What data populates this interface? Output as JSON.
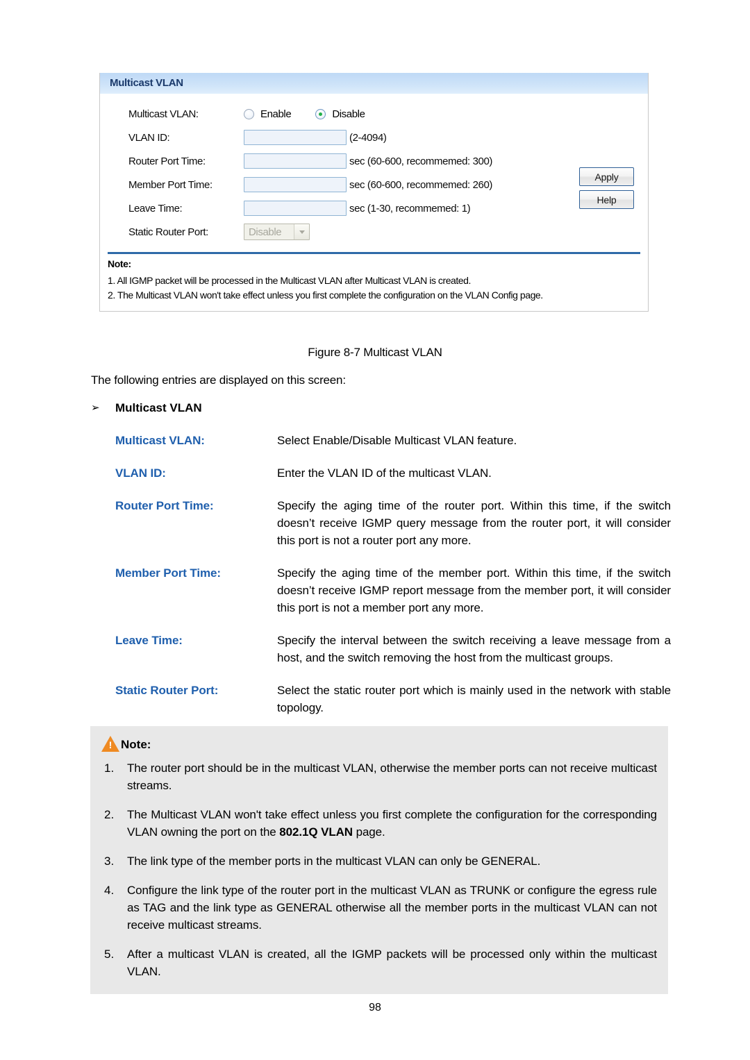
{
  "figure": {
    "panel_title": "Multicast VLAN",
    "rows": [
      {
        "label": "Multicast VLAN:",
        "type": "radio"
      },
      {
        "label": "VLAN ID:",
        "type": "text",
        "value": "",
        "hint": "(2-4094)"
      },
      {
        "label": "Router Port Time:",
        "type": "text",
        "value": "",
        "hint": "sec (60-600, recommemed: 300)"
      },
      {
        "label": "Member Port Time:",
        "type": "text",
        "value": "",
        "hint": "sec (60-600, recommemed: 260)"
      },
      {
        "label": "Leave Time:",
        "type": "text",
        "value": "",
        "hint": "sec (1-30, recommemed: 1)"
      },
      {
        "label": "Static Router Port:",
        "type": "select",
        "value": "Disable"
      }
    ],
    "radio": {
      "enable_label": "Enable",
      "disable_label": "Disable",
      "selected": "Disable"
    },
    "buttons": {
      "apply": "Apply",
      "help": "Help"
    },
    "note": {
      "heading": "Note:",
      "line1": "1. All IGMP packet will be processed in the Multicast VLAN after Multicast VLAN is created.",
      "line2": "2. The Multicast VLAN won't take effect unless you first complete the configuration on the VLAN Config page."
    }
  },
  "document": {
    "figure_caption": "Figure 8-7 Multicast VLAN",
    "intro": "The following entries are displayed on this screen:",
    "bullet_marker": "➢",
    "bullet_heading": "Multicast VLAN",
    "definitions": [
      {
        "term": "Multicast VLAN:",
        "desc": "Select Enable/Disable Multicast VLAN feature."
      },
      {
        "term": "VLAN ID:",
        "desc": "Enter the VLAN ID of the multicast VLAN."
      },
      {
        "term": "Router Port Time:",
        "desc": "Specify the aging time of the router port. Within this time, if the switch doesn’t receive IGMP query message from the router port, it will consider this port is not a router port any more."
      },
      {
        "term": "Member Port Time:",
        "desc": "Specify the aging time of the member port. Within this time, if the switch doesn’t receive IGMP report message from the member port, it will consider this port is not a member port any more."
      },
      {
        "term": "Leave Time:",
        "desc": "Specify the interval between the switch receiving a leave message from a host, and the switch removing the host from the multicast groups."
      },
      {
        "term": "Static Router Port:",
        "desc": "Select the static router port which is mainly used in the network with stable topology."
      }
    ],
    "note_box": {
      "heading": "Note:",
      "items": [
        {
          "num": "1.",
          "text_before": "The router port should be in the multicast VLAN, otherwise the member ports can not receive multicast streams.",
          "bold": "",
          "text_after": ""
        },
        {
          "num": "2.",
          "text_before": "The Multicast VLAN won't take effect unless you first complete the configuration for the corresponding VLAN owning the port on the ",
          "bold": "802.1Q VLAN",
          "text_after": " page."
        },
        {
          "num": "3.",
          "text_before": "The link type of the member ports in the multicast VLAN can only be GENERAL.",
          "bold": "",
          "text_after": ""
        },
        {
          "num": "4.",
          "text_before": "Configure the link type of the router port in the multicast VLAN as TRUNK or configure the egress rule as TAG and the link type as GENERAL otherwise all the member ports in the multicast VLAN can not receive multicast streams.",
          "bold": "",
          "text_after": ""
        },
        {
          "num": "5.",
          "text_before": "After a multicast VLAN is created, all the IGMP packets will be processed only within the multicast VLAN.",
          "bold": "",
          "text_after": ""
        }
      ]
    },
    "page_number": "98"
  }
}
